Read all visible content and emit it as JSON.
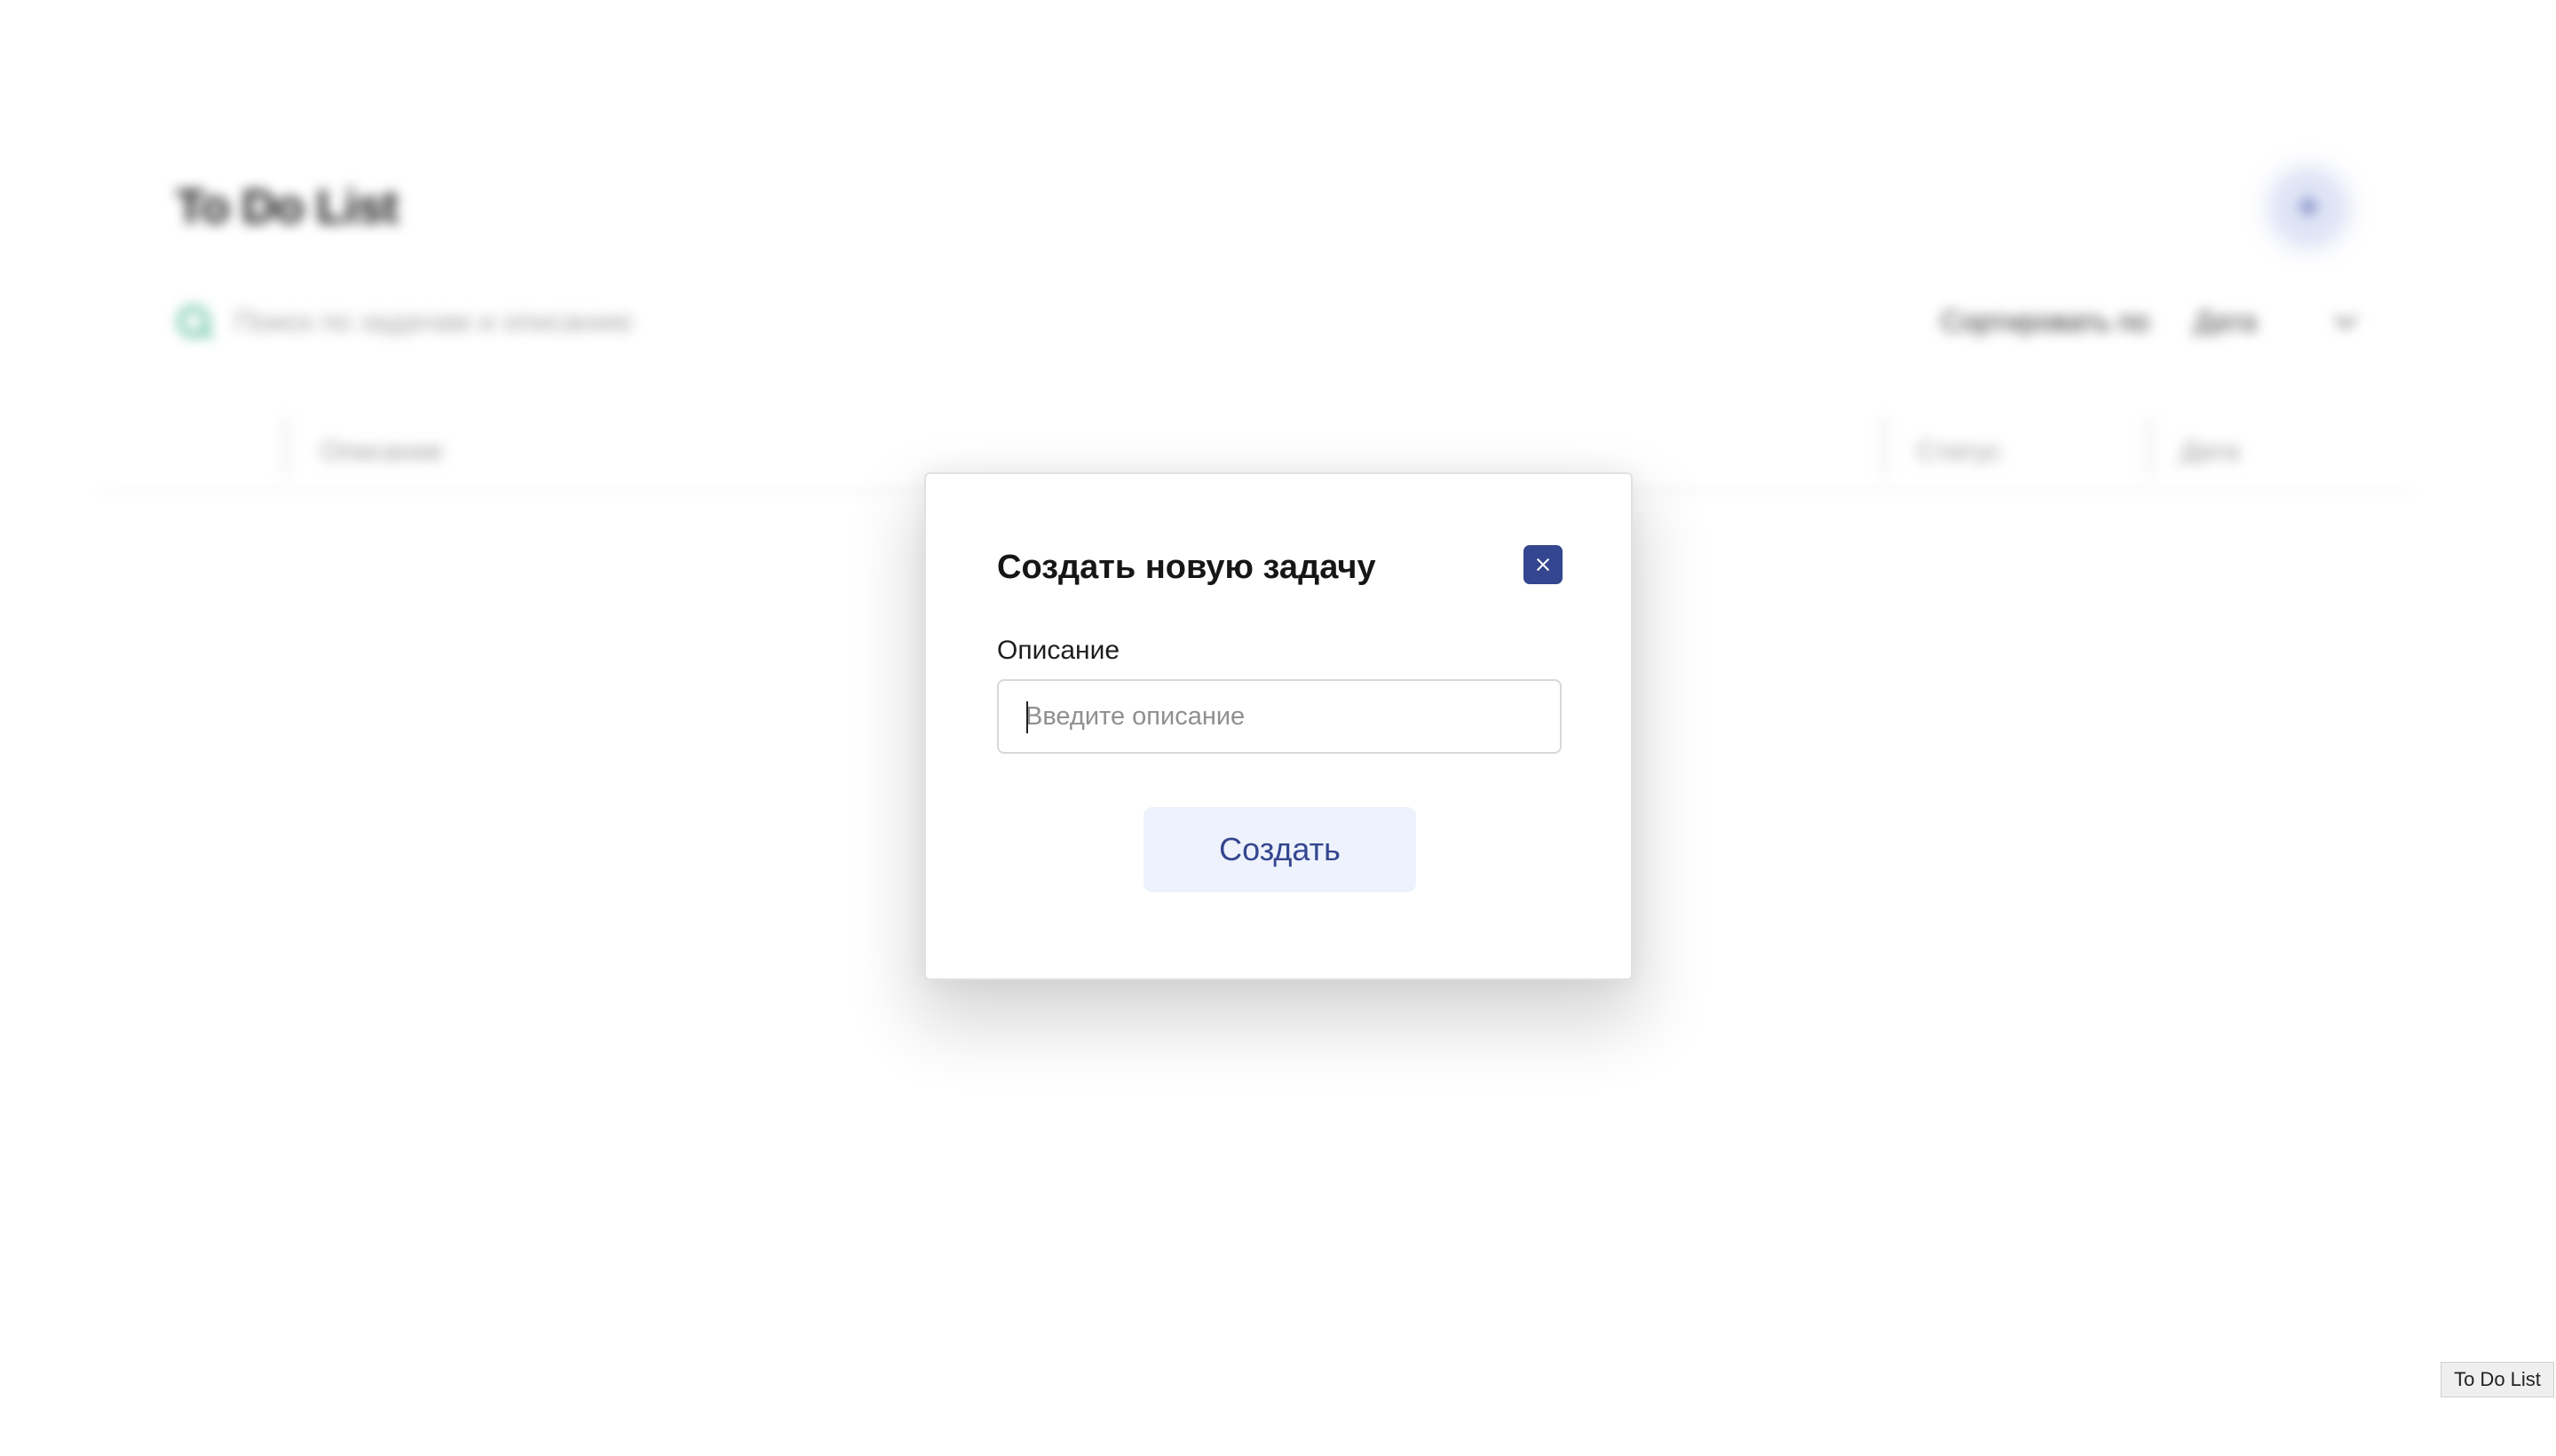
{
  "app": {
    "title": "To Do List",
    "add_button_icon": "plus-icon"
  },
  "search": {
    "placeholder": "Поиск по задачам и описанию"
  },
  "sort": {
    "label": "Сортировать по",
    "selected": "Дата"
  },
  "table": {
    "columns": [
      "Описание",
      "Статус",
      "Дата"
    ]
  },
  "modal": {
    "title": "Создать новую задачу",
    "close_icon": "close-icon",
    "description_label": "Описание",
    "description_value": "",
    "description_placeholder": "Введите описание",
    "submit_label": "Создать"
  },
  "tooltip": {
    "text": "To Do List"
  },
  "colors": {
    "accent": "#34468f",
    "button_bg": "#eef2fc",
    "search_icon": "#5fbf9e"
  }
}
